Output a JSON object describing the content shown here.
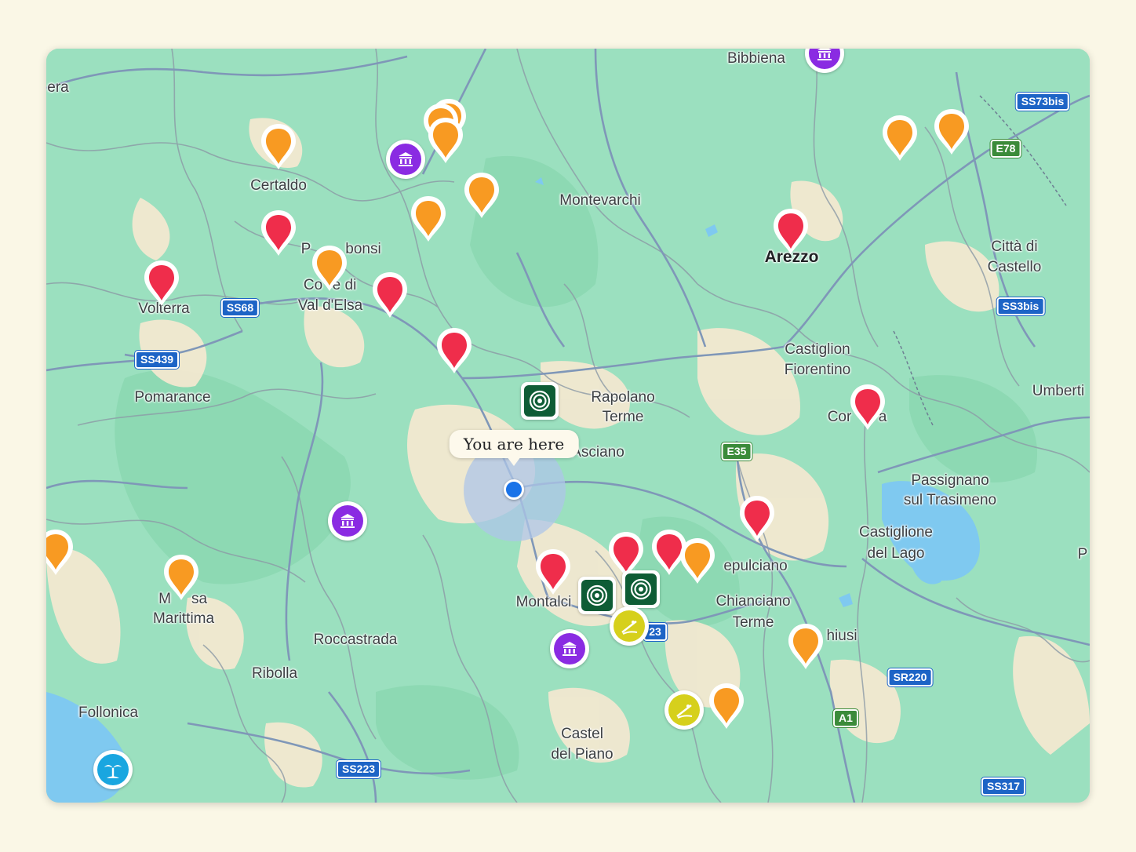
{
  "map": {
    "current_location_label": "You are here",
    "places": [
      {
        "name": "era",
        "bold": false
      },
      {
        "name": "Bibbiena",
        "bold": false
      },
      {
        "name": "Certaldo",
        "bold": false
      },
      {
        "name": "Montevarchi",
        "bold": false
      },
      {
        "name": "P",
        "bold": false
      },
      {
        "name": "bonsi",
        "bold": false
      },
      {
        "name": "Co",
        "bold": false
      },
      {
        "name": "e di",
        "bold": false
      },
      {
        "name": "Val d'Elsa",
        "bold": false
      },
      {
        "name": "Volterra",
        "bold": false
      },
      {
        "name": "Arezzo",
        "bold": true
      },
      {
        "name": "Città di",
        "bold": false
      },
      {
        "name": "Castello",
        "bold": false
      },
      {
        "name": "Castiglion",
        "bold": false
      },
      {
        "name": "Fiorentino",
        "bold": false
      },
      {
        "name": "Pomarance",
        "bold": false
      },
      {
        "name": "Rapolano",
        "bold": false
      },
      {
        "name": "Terme",
        "bold": false
      },
      {
        "name": "Asciano",
        "bold": false
      },
      {
        "name": "Umberti",
        "bold": false
      },
      {
        "name": "Cor",
        "bold": false
      },
      {
        "name": "a",
        "bold": false
      },
      {
        "name": "Passignano",
        "bold": false
      },
      {
        "name": "sul Trasimeno",
        "bold": false
      },
      {
        "name": "Castiglione",
        "bold": false
      },
      {
        "name": "del Lago",
        "bold": false
      },
      {
        "name": "P",
        "bold": false
      },
      {
        "name": "M",
        "bold": false
      },
      {
        "name": "sa",
        "bold": false
      },
      {
        "name": "Marittima",
        "bold": false
      },
      {
        "name": "Montalci",
        "bold": false
      },
      {
        "name": "epulciano",
        "bold": false
      },
      {
        "name": "Chianciano",
        "bold": false
      },
      {
        "name": "Terme",
        "bold": false
      },
      {
        "name": "hiusi",
        "bold": false
      },
      {
        "name": "Roccastrada",
        "bold": false
      },
      {
        "name": "Ribolla",
        "bold": false
      },
      {
        "name": "Follonica",
        "bold": false
      },
      {
        "name": "Castel",
        "bold": false
      },
      {
        "name": "del Piano",
        "bold": false
      }
    ],
    "road_shields": [
      {
        "label": "SS73bis",
        "color": "blue"
      },
      {
        "label": "E78",
        "color": "green"
      },
      {
        "label": "SS68",
        "color": "blue"
      },
      {
        "label": "SS439",
        "color": "blue"
      },
      {
        "label": "SS3bis",
        "color": "blue"
      },
      {
        "label": "E35",
        "color": "green"
      },
      {
        "label": "23",
        "color": "blue"
      },
      {
        "label": "SR220",
        "color": "blue"
      },
      {
        "label": "A1",
        "color": "green"
      },
      {
        "label": "SS223",
        "color": "blue"
      },
      {
        "label": "SS317",
        "color": "blue"
      }
    ],
    "markers": [
      {
        "type": "museum",
        "icon": "museum-icon"
      },
      {
        "type": "orange",
        "icon": "orange-pin-icon"
      },
      {
        "type": "orange",
        "icon": "orange-pin-icon"
      },
      {
        "type": "orange",
        "icon": "orange-pin-icon"
      },
      {
        "type": "orange",
        "icon": "orange-pin-icon"
      },
      {
        "type": "orange",
        "icon": "orange-pin-icon"
      },
      {
        "type": "museum",
        "icon": "museum-icon"
      },
      {
        "type": "orange",
        "icon": "orange-pin-icon"
      },
      {
        "type": "orange",
        "icon": "orange-pin-icon"
      },
      {
        "type": "orange",
        "icon": "orange-pin-icon"
      },
      {
        "type": "orange",
        "icon": "orange-pin-icon"
      },
      {
        "type": "red",
        "icon": "red-pin-icon"
      },
      {
        "type": "red",
        "icon": "red-pin-icon"
      },
      {
        "type": "red",
        "icon": "red-pin-icon"
      },
      {
        "type": "red",
        "icon": "red-pin-icon"
      },
      {
        "type": "red",
        "icon": "red-pin-icon"
      },
      {
        "type": "spiral",
        "icon": "spiral-icon"
      },
      {
        "type": "red",
        "icon": "red-pin-icon"
      },
      {
        "type": "museum",
        "icon": "museum-icon"
      },
      {
        "type": "orange",
        "icon": "orange-pin-icon"
      },
      {
        "type": "orange",
        "icon": "orange-pin-icon"
      },
      {
        "type": "red",
        "icon": "red-pin-icon"
      },
      {
        "type": "red",
        "icon": "red-pin-icon"
      },
      {
        "type": "red",
        "icon": "red-pin-icon"
      },
      {
        "type": "orange",
        "icon": "orange-pin-icon"
      },
      {
        "type": "red",
        "icon": "red-pin-icon"
      },
      {
        "type": "spiral",
        "icon": "spiral-icon"
      },
      {
        "type": "spiral",
        "icon": "spiral-icon"
      },
      {
        "type": "hiking",
        "icon": "hiking-icon"
      },
      {
        "type": "museum",
        "icon": "museum-icon"
      },
      {
        "type": "orange",
        "icon": "orange-pin-icon"
      },
      {
        "type": "hiking",
        "icon": "hiking-icon"
      },
      {
        "type": "orange",
        "icon": "orange-pin-icon"
      },
      {
        "type": "beach",
        "icon": "beach-icon"
      }
    ]
  },
  "colors": {
    "land": "#9be0bf",
    "urban": "#f2e8d0",
    "water": "#7fc9f0",
    "red_pin": "#ef2d4b",
    "orange_pin": "#f89a22",
    "museum": "#8a2be2",
    "spiral": "#0e5c35",
    "hiking": "#d6d01c",
    "beach": "#19a6e0",
    "location_dot": "#1a73e8"
  }
}
